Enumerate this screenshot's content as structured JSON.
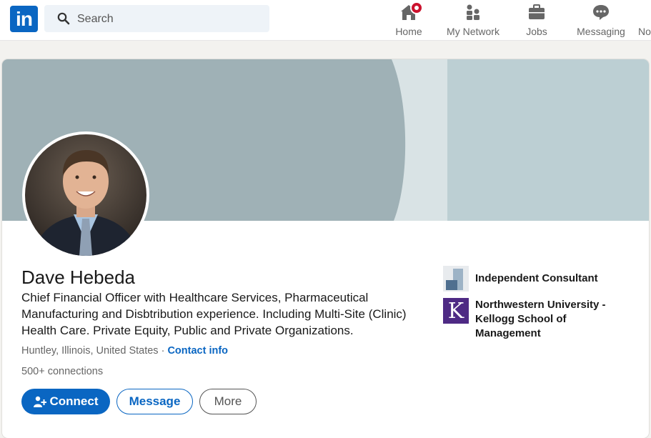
{
  "nav": {
    "logo_text": "in",
    "search_placeholder": "Search",
    "items": [
      {
        "label": "Home",
        "icon": "home-icon"
      },
      {
        "label": "My Network",
        "icon": "network-icon"
      },
      {
        "label": "Jobs",
        "icon": "briefcase-icon"
      },
      {
        "label": "Messaging",
        "icon": "messaging-icon"
      },
      {
        "label": "No",
        "icon": "notifications-icon"
      }
    ]
  },
  "profile": {
    "name": "Dave Hebeda",
    "headline": "Chief Financial Officer with Healthcare Services, Pharmaceutical Manufacturing and Disbtribution experience. Including Multi-Site (Clinic) Health Care. Private Equity, Public and Private Organizations.",
    "location": "Huntley, Illinois, United States",
    "separator": "·",
    "contact_info_label": "Contact info",
    "connections": "500+ connections",
    "actions": {
      "connect_label": "Connect",
      "message_label": "Message",
      "more_label": "More"
    },
    "experience": {
      "current_position": "Independent Consultant",
      "education": "Northwestern University - Kellogg School of Management",
      "education_logo_letter": "K"
    }
  },
  "colors": {
    "brand": "#0a66c2",
    "badge": "#cb112d",
    "banner_main": "#9fb1b6",
    "banner_light": "#d9e3e5",
    "banner_right": "#bccfd3",
    "kellogg_purple": "#4e2a84"
  }
}
